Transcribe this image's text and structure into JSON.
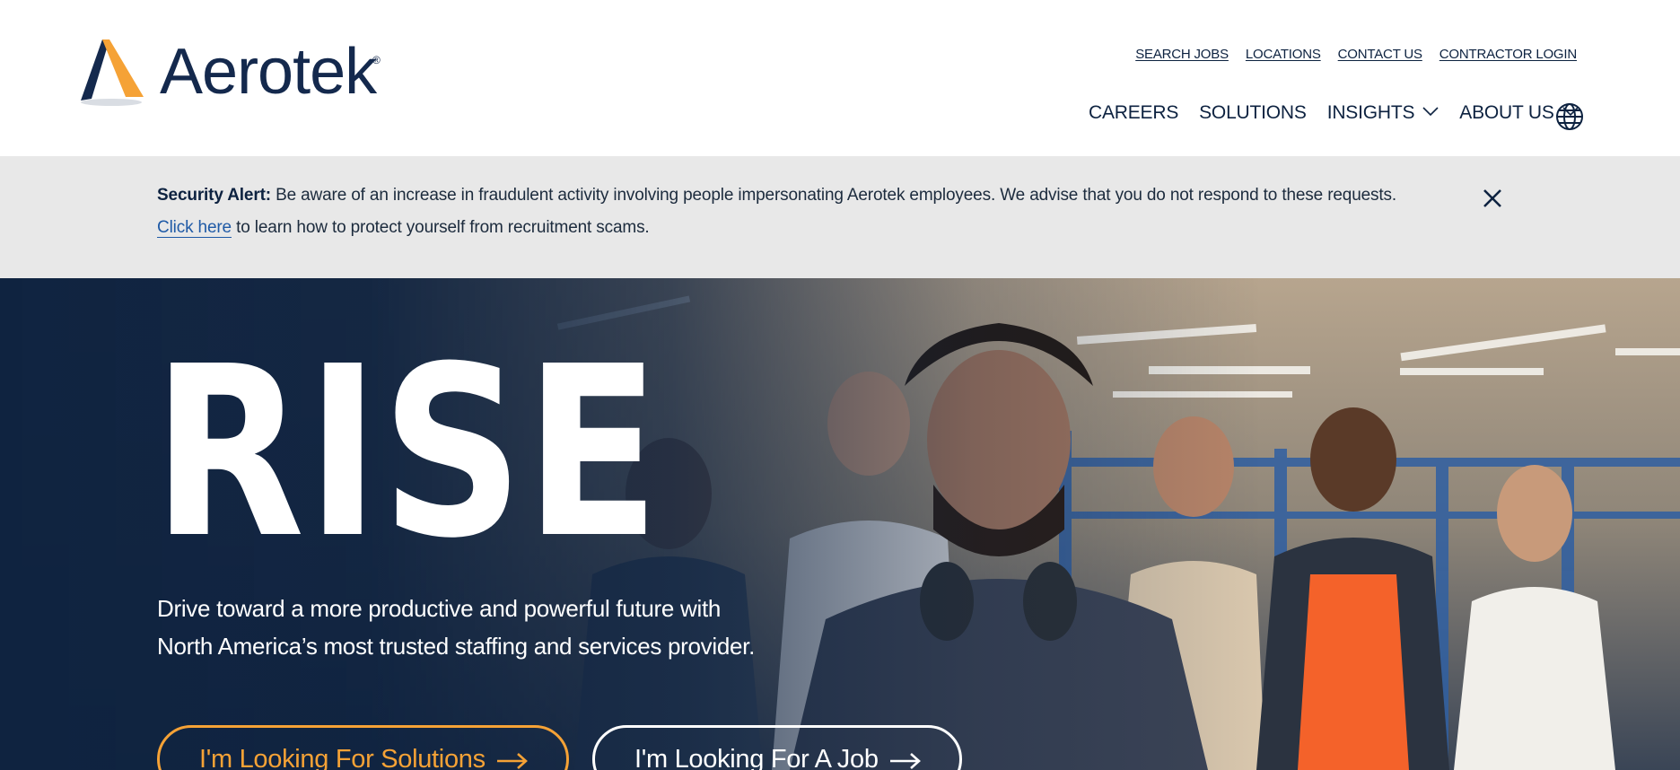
{
  "brand": {
    "name": "Aerotek",
    "registered_mark": "®",
    "colors": {
      "navy": "#14294d",
      "orange": "#f5a236",
      "hero_bg": "#0f2340",
      "alert_bg": "#e8e8e8",
      "link_blue": "#1f5aa6"
    }
  },
  "utility_nav": [
    {
      "label": "SEARCH JOBS"
    },
    {
      "label": "LOCATIONS"
    },
    {
      "label": "CONTACT US"
    },
    {
      "label": "CONTRACTOR LOGIN"
    }
  ],
  "main_nav": [
    {
      "label": "CAREERS",
      "has_dropdown": false
    },
    {
      "label": "SOLUTIONS",
      "has_dropdown": false
    },
    {
      "label": "INSIGHTS",
      "has_dropdown": true
    },
    {
      "label": "ABOUT US",
      "has_dropdown": true
    }
  ],
  "icons": {
    "language": "globe-icon",
    "close": "close-icon",
    "dropdown": "chevron-down-icon",
    "cta": "arrow-right-icon"
  },
  "alert": {
    "heading": "Security Alert:",
    "message": "Be aware of an increase in fraudulent activity involving people impersonating Aerotek employees. We advise that you do not respond to these requests.",
    "link_text": "Click here",
    "trailing": "to learn how to protect yourself from recruitment scams."
  },
  "hero": {
    "title": "RISE",
    "subtitle_line1": "Drive toward a more productive and powerful future with",
    "subtitle_line2": "North America’s most trusted staffing and services provider.",
    "primary_cta": "I'm Looking For Solutions",
    "secondary_cta": "I'm Looking For A Job"
  }
}
